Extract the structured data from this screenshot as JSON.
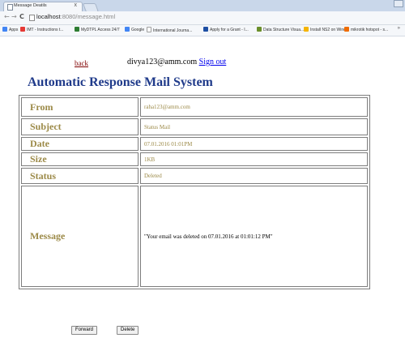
{
  "browser": {
    "tab_title": "Message Deatils",
    "tab_close": "x",
    "url_host": "localhost",
    "url_path": ":8080/message.html",
    "bookmarks": [
      {
        "label": "Apps",
        "color": "#4285f4"
      },
      {
        "label": "IMT - Instructions t...",
        "color": "#e53935"
      },
      {
        "label": "MyDTPL Access 24/7",
        "color": "#2e7d32"
      },
      {
        "label": "Google",
        "color": "#4285f4"
      },
      {
        "label": "International Journa...",
        "color": "#9e9e9e"
      },
      {
        "label": "Apply for a Grant - I...",
        "color": "#1e4fa3"
      },
      {
        "label": "Data Structure Visua...",
        "color": "#6a8f2a"
      },
      {
        "label": "Install NS2 on Wind...",
        "color": "#f5b400"
      },
      {
        "label": "mikrotik hotspot - s...",
        "color": "#ef6c00"
      }
    ],
    "bookmarks_more": "»"
  },
  "header": {
    "back_label": "back",
    "user_email": "divya123@amm.com",
    "signout_label": "Sign out"
  },
  "page_title": "Automatic Response Mail System",
  "mail": {
    "rows": [
      {
        "label": "From",
        "value": "raha123@amm.com"
      },
      {
        "label": "Subject",
        "value": "Status Mail"
      },
      {
        "label": "Date",
        "value": "07.01.2016 01:01PM"
      },
      {
        "label": "Size",
        "value": "1KB"
      },
      {
        "label": "Status",
        "value": "Deleted"
      },
      {
        "label": "Message",
        "value": "\"Your email was deleted on 07.01.2016 at 01:01:12 PM\""
      }
    ]
  },
  "actions": {
    "forward_label": "Forward",
    "delete_label": "Delete"
  },
  "colors": {
    "title": "#1f3a8a",
    "field_text": "#9c8a48",
    "back_link": "#800000",
    "signout_link": "#0000ee"
  }
}
